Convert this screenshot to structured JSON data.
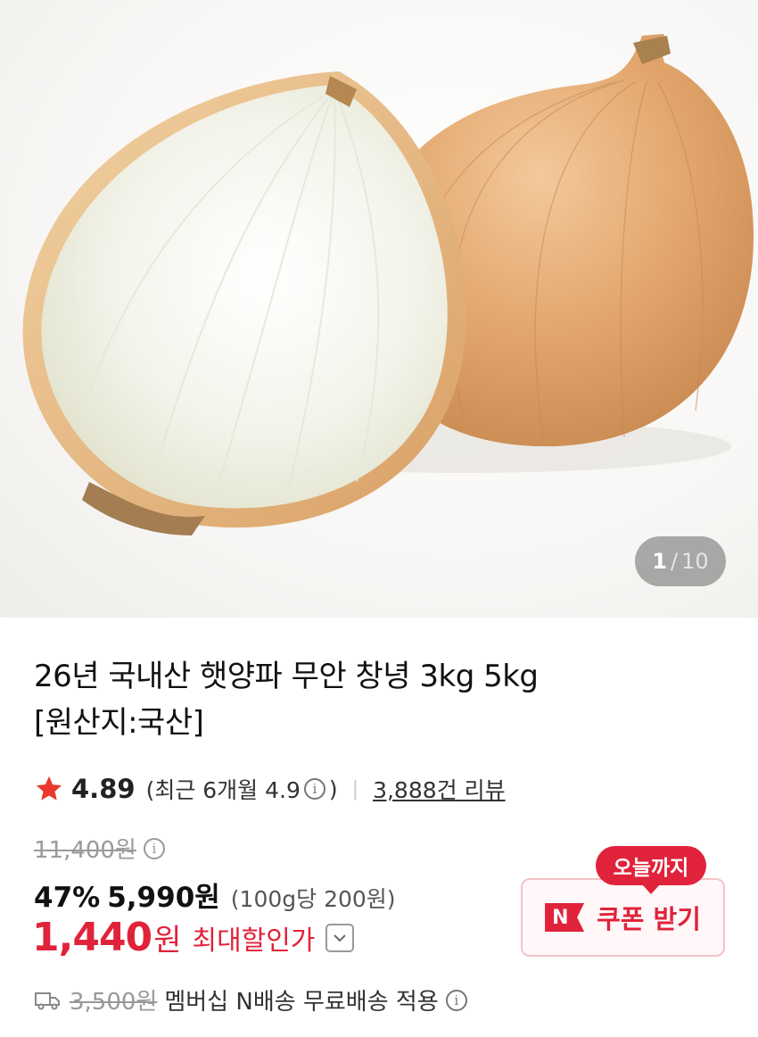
{
  "hero": {
    "image_desc_icon": "onion-photo",
    "counter_current": "1",
    "counter_sep": "/",
    "counter_total": "10"
  },
  "product": {
    "title_line1": "26년 국내산 햇양파 무안 창녕 3kg 5kg",
    "title_line2": "[원산지:국산]"
  },
  "rating": {
    "score": "4.89",
    "recent_prefix": "(최근 6개월 4.9",
    "recent_suffix": ")",
    "divider": "|",
    "reviews": "3,888건 리뷰"
  },
  "price": {
    "original": "11,400원",
    "discount": "47%",
    "sale": "5,990원",
    "unit_price": "(100g당 200원)",
    "max_discount_value": "1,440",
    "max_discount_won": "원",
    "max_discount_label": "최대할인가"
  },
  "coupon": {
    "badge": "오늘까지",
    "n_label": "N",
    "label": "쿠폰 받기"
  },
  "shipping": {
    "fee": "3,500원",
    "text": "멤버십 N배송 무료배송 적용"
  },
  "colors": {
    "accent_red": "#e0233b",
    "star": "#e8392a"
  }
}
